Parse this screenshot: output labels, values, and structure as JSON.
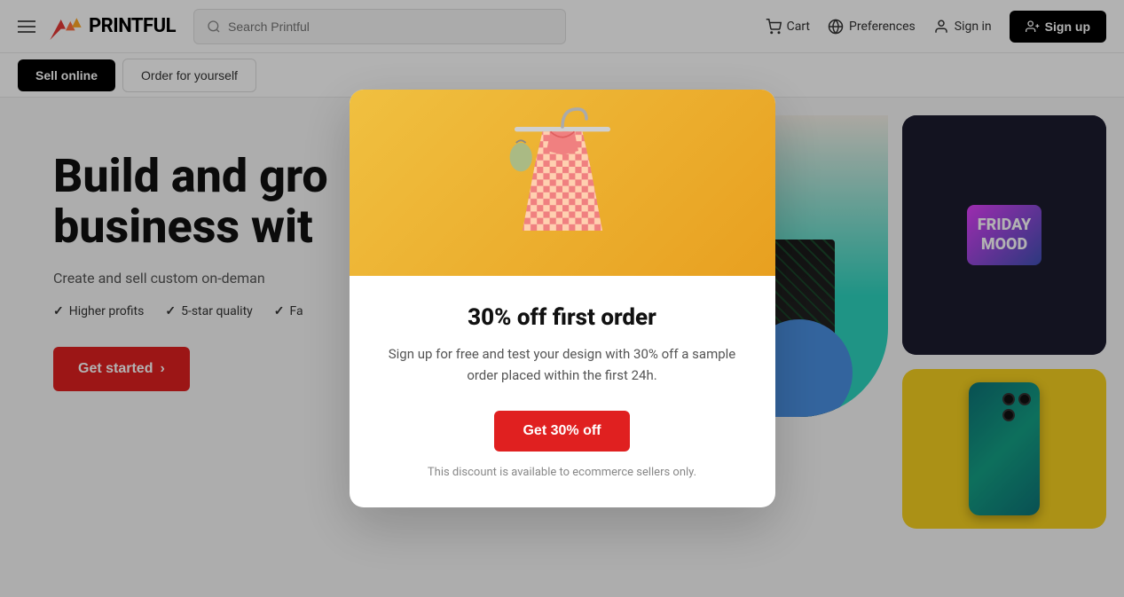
{
  "navbar": {
    "logo_text": "PRINTFUL",
    "search_placeholder": "Search Printful",
    "cart_label": "Cart",
    "preferences_label": "Preferences",
    "signin_label": "Sign in",
    "signup_label": "Sign up"
  },
  "subnav": {
    "sell_online_label": "Sell online",
    "order_for_yourself_label": "Order for yourself"
  },
  "hero": {
    "title": "Build and gro\nbusiness wit",
    "subtitle": "Create and sell custom on-deman",
    "check1": "Higher profits",
    "check2": "5-star quality",
    "check3": "Fa",
    "cta_label": "Get started",
    "cta_arrow": "›"
  },
  "modal": {
    "close_icon": "×",
    "title": "30% off first order",
    "description": "Sign up for free and test your design with 30% off a sample order placed within the first 24h.",
    "cta_label": "Get 30% off",
    "disclaimer": "This discount is available to ecommerce sellers only."
  }
}
